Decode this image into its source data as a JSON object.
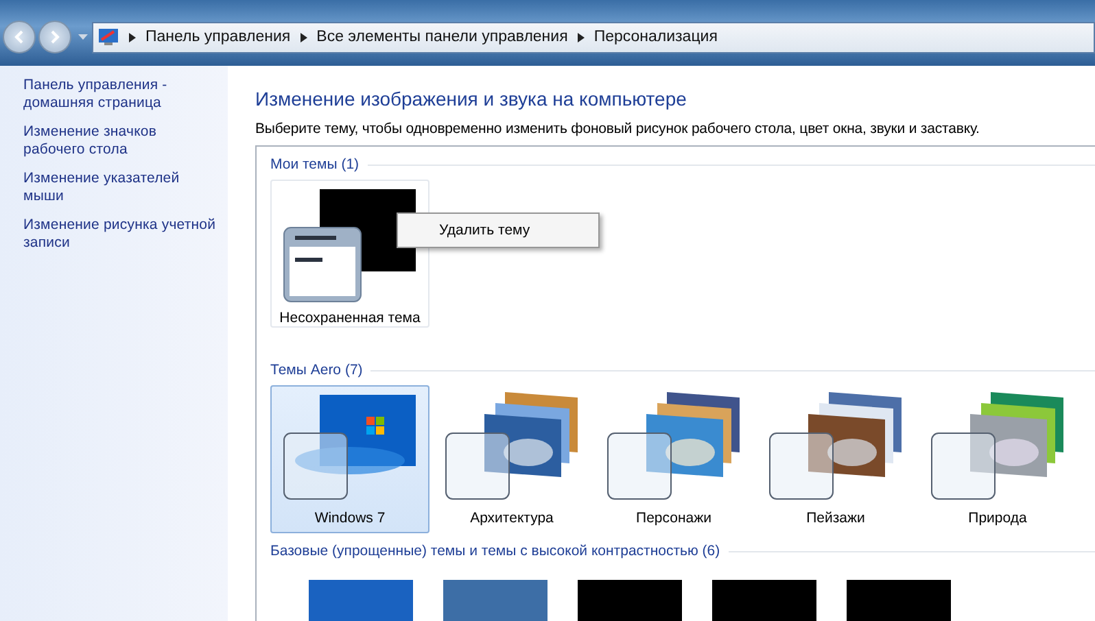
{
  "address_bar": {
    "breadcrumbs": [
      "Панель управления",
      "Все элементы панели управления",
      "Персонализация"
    ]
  },
  "sidebar": {
    "links": [
      "Панель управления - домашняя страница",
      "Изменение значков рабочего стола",
      "Изменение указателей мыши",
      "Изменение рисунка учетной записи"
    ]
  },
  "title": "Изменение изображения и звука на компьютере",
  "subtitle": "Выберите тему, чтобы одновременно изменить фоновый рисунок рабочего стола, цвет окна, звуки и заставку.",
  "my_themes": {
    "heading": "Мои темы (1)",
    "themes": [
      {
        "name": "Несохраненная тема",
        "selected": false
      }
    ]
  },
  "context_menu": {
    "items": [
      "Удалить тему"
    ]
  },
  "aero_themes": {
    "heading": "Темы Aero (7)",
    "themes": [
      {
        "name": "Windows 7",
        "selected": true
      },
      {
        "name": "Архитектура",
        "selected": false
      },
      {
        "name": "Персонажи",
        "selected": false
      },
      {
        "name": "Пейзажи",
        "selected": false
      },
      {
        "name": "Природа",
        "selected": false
      }
    ]
  },
  "basic_themes": {
    "heading": "Базовые (упрощенные) темы и темы с высокой контрастностью (6)",
    "themes": [
      {
        "color": "#1a62c0"
      },
      {
        "color": "#3d6ea6"
      },
      {
        "color": "#000000"
      },
      {
        "color": "#000000"
      },
      {
        "color": "#000000"
      }
    ]
  }
}
